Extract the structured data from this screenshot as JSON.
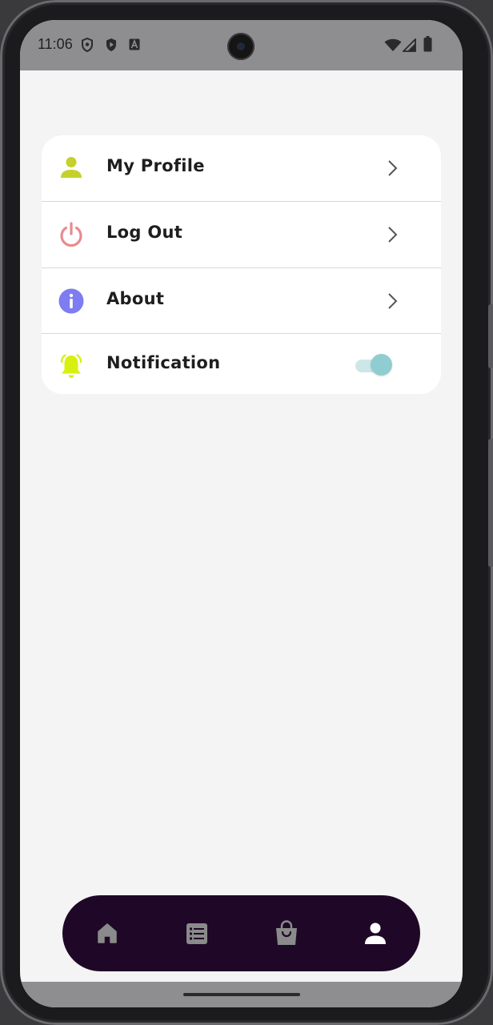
{
  "status_bar": {
    "time": "11:06",
    "icons": [
      "shield-icon",
      "play-protect-icon",
      "font-a-icon",
      "wifi-icon",
      "cell-signal-icon",
      "battery-icon"
    ]
  },
  "menu": {
    "items": [
      {
        "label": "My Profile",
        "icon": "person-icon",
        "icon_color": "#c5d12a",
        "trailing": "chevron-right-icon"
      },
      {
        "label": "Log Out",
        "icon": "power-icon",
        "icon_color": "#e98a8f",
        "trailing": "chevron-right-icon"
      },
      {
        "label": "About",
        "icon": "info-icon",
        "icon_color": "#7d7cf0",
        "trailing": "chevron-right-icon"
      },
      {
        "label": "Notification",
        "icon": "bell-icon",
        "icon_color": "#d8f010",
        "trailing": "toggle",
        "toggle_on": true
      }
    ]
  },
  "bottom_nav": {
    "background": "#1f0827",
    "items": [
      {
        "icon": "home-icon",
        "active": false
      },
      {
        "icon": "list-icon",
        "active": false
      },
      {
        "icon": "shopping-bag-icon",
        "active": false
      },
      {
        "icon": "person-icon",
        "active": true
      }
    ],
    "inactive_color": "#8a8a8a",
    "active_color": "#ffffff"
  }
}
